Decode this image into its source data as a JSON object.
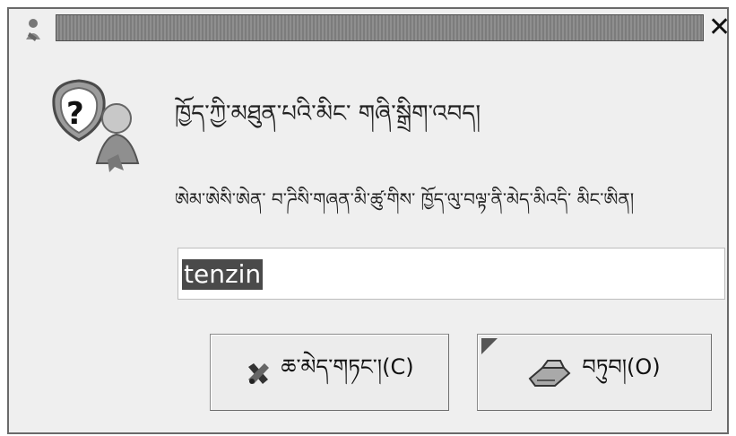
{
  "window": {
    "close_glyph": "✕",
    "app_icon": "user-icon",
    "close_icon": "close-icon"
  },
  "dialog": {
    "icon": "user-question-icon",
    "title": "ཁྱོད་ཀྱི་མཐུན་པའི་མིང་ གཞི་སྒྲིག་འབད།",
    "message": "ཨེམ་ཨེསི་ཨེན་ བ་ཌིསི་གཞན་མི་ཚུ་གིས་ ཁྱོད་ལུ་བལྟ་ནི་མེད་མིའདི་ མིང་ཨིན།",
    "entry_value": "tenzin"
  },
  "buttons": {
    "cancel_label": "ཆ་མེད་གཏང་།(C)",
    "cancel_mnemonic": "C",
    "cancel_icon": "cancel-icon",
    "ok_label": "བཏུབ།(O)",
    "ok_mnemonic": "O",
    "ok_icon": "ok-icon"
  }
}
